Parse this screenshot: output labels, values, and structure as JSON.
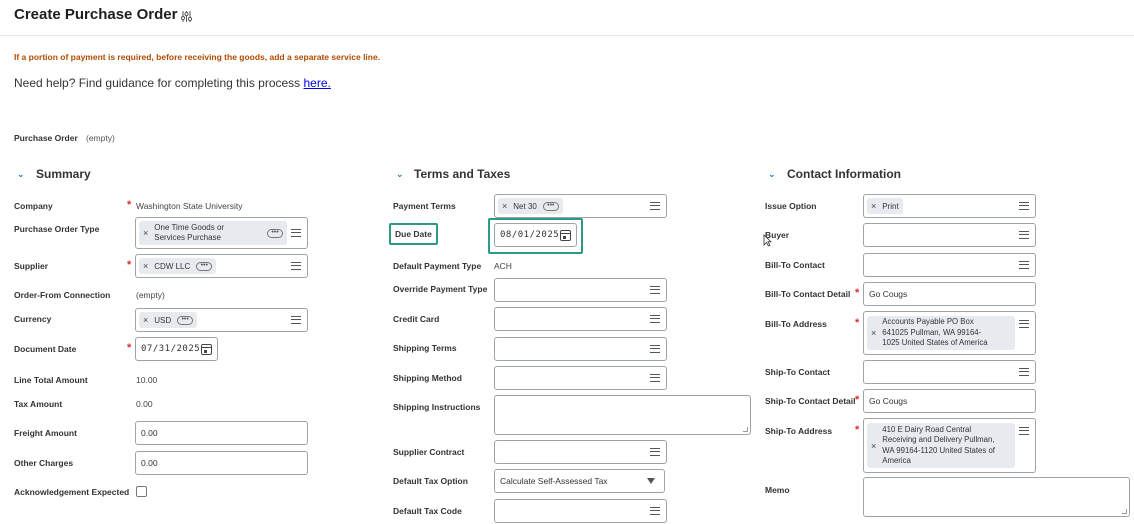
{
  "header": {
    "title": "Create Purchase Order",
    "settings_icon": "sliders-icon"
  },
  "notice": "If a portion of payment is required, before receiving the goods, add a separate service line.",
  "help": {
    "text": "Need help? Find guidance for completing this process ",
    "link": "here."
  },
  "purchase_order": {
    "label": "Purchase Order",
    "value": "(empty)"
  },
  "summary": {
    "heading": "Summary",
    "company": {
      "label": "Company",
      "value": "Washington State University"
    },
    "po_type": {
      "label": "Purchase Order Type",
      "line1": "One Time Goods or",
      "line2": "Services Purchase"
    },
    "supplier": {
      "label": "Supplier",
      "value": "CDW LLC"
    },
    "order_from": {
      "label": "Order-From Connection",
      "value": "(empty)"
    },
    "currency": {
      "label": "Currency",
      "value": "USD"
    },
    "document_date": {
      "label": "Document Date",
      "value": "07/31/2025"
    },
    "line_total": {
      "label": "Line Total Amount",
      "value": "10.00"
    },
    "tax_amount": {
      "label": "Tax Amount",
      "value": "0.00"
    },
    "freight": {
      "label": "Freight Amount",
      "value": "0.00"
    },
    "other_charges": {
      "label": "Other Charges",
      "value": "0.00"
    },
    "ack": {
      "label": "Acknowledgement Expected",
      "checked": false
    }
  },
  "terms": {
    "heading": "Terms and Taxes",
    "payment_terms": {
      "label": "Payment Terms",
      "value": "Net 30"
    },
    "due_date": {
      "label": "Due Date",
      "value": "08/01/2025"
    },
    "default_payment_type": {
      "label": "Default Payment Type",
      "value": "ACH"
    },
    "override_payment_type": {
      "label": "Override Payment Type",
      "value": ""
    },
    "credit_card": {
      "label": "Credit Card",
      "value": ""
    },
    "shipping_terms": {
      "label": "Shipping Terms",
      "value": ""
    },
    "shipping_method": {
      "label": "Shipping Method",
      "value": ""
    },
    "shipping_instructions": {
      "label": "Shipping Instructions",
      "value": ""
    },
    "supplier_contract": {
      "label": "Supplier Contract",
      "value": ""
    },
    "default_tax_option": {
      "label": "Default Tax Option",
      "value": "Calculate Self-Assessed Tax"
    },
    "default_tax_code": {
      "label": "Default Tax Code",
      "value": ""
    }
  },
  "contact": {
    "heading": "Contact Information",
    "issue_option": {
      "label": "Issue Option",
      "value": "Print"
    },
    "buyer": {
      "label": "Buyer",
      "value": ""
    },
    "bill_to_contact": {
      "label": "Bill-To Contact",
      "value": ""
    },
    "bill_to_contact_detail": {
      "label": "Bill-To Contact Detail",
      "value": "Go Cougs"
    },
    "bill_to_address": {
      "label": "Bill-To Address",
      "line1": "Accounts Payable PO Box",
      "line2": "641025 Pullman, WA 99164-",
      "line3": "1025 United States of America"
    },
    "ship_to_contact": {
      "label": "Ship-To Contact",
      "value": ""
    },
    "ship_to_contact_detail": {
      "label": "Ship-To Contact Detail",
      "value": "Go Cougs"
    },
    "ship_to_address": {
      "label": "Ship-To Address",
      "line1": "410 E Dairy Road Central",
      "line2": "Receiving and Delivery Pullman,",
      "line3": "WA 99164-1120 United States of",
      "line4": "America"
    },
    "memo": {
      "label": "Memo",
      "value": ""
    }
  },
  "colors": {
    "required": "#de2e21",
    "notice": "#b14b00",
    "highlight": "#2c9a85",
    "chevron": "#0875e1"
  }
}
